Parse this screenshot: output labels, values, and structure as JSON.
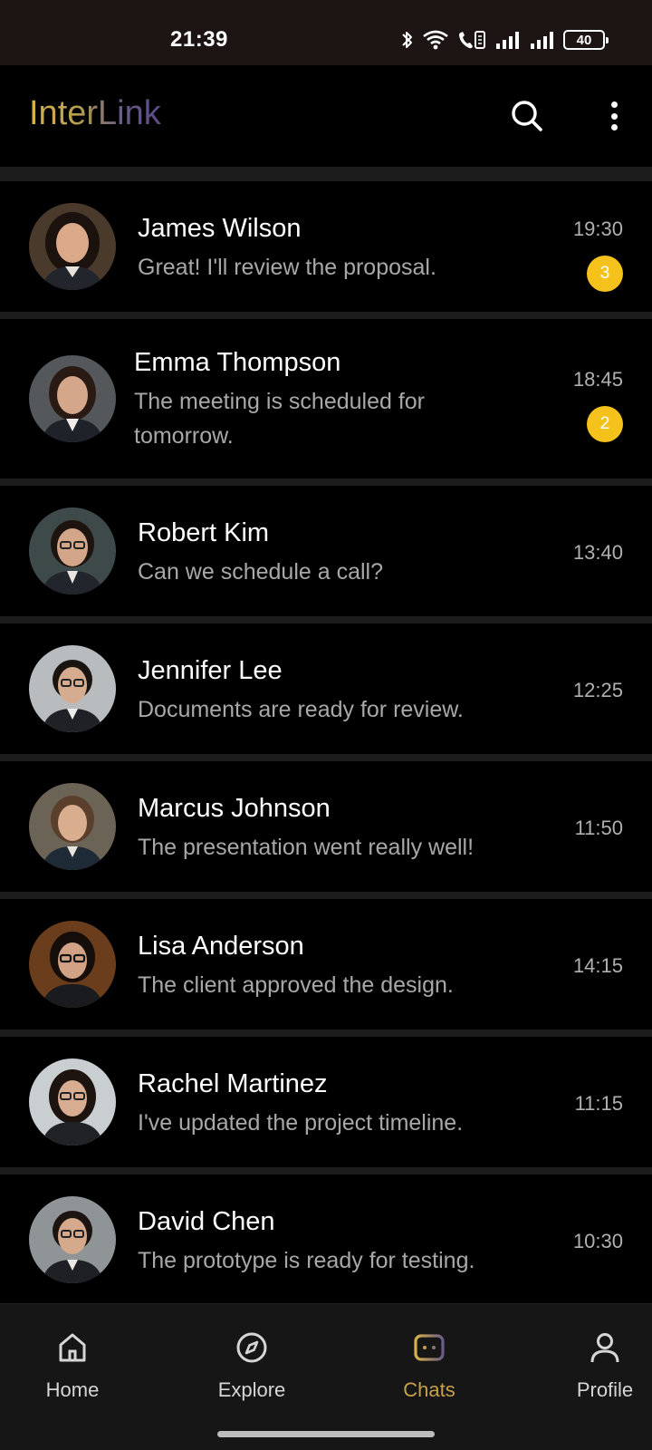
{
  "status_bar": {
    "time": "21:39",
    "icons": [
      "bluetooth-icon",
      "wifi-icon",
      "volte-call-icon",
      "signal-icon",
      "signal-icon"
    ],
    "battery": "40"
  },
  "app_bar": {
    "title": "InterLink",
    "title_gradient": [
      "#d6b24a",
      "#5b4a88"
    ],
    "icons": [
      "search-icon",
      "more-vertical-icon"
    ]
  },
  "chats": [
    {
      "name": "James Wilson",
      "preview": "Great! I'll review the proposal.",
      "time": "19:30",
      "unread": "3"
    },
    {
      "name": "Emma Thompson",
      "preview": "The meeting is scheduled for tomorrow.",
      "time": "18:45",
      "unread": "2"
    },
    {
      "name": "Robert Kim",
      "preview": "Can we schedule a call?",
      "time": "13:40",
      "unread": ""
    },
    {
      "name": "Jennifer Lee",
      "preview": "Documents are ready for review.",
      "time": "12:25",
      "unread": ""
    },
    {
      "name": "Marcus Johnson",
      "preview": "The presentation went really well!",
      "time": "11:50",
      "unread": ""
    },
    {
      "name": "Lisa Anderson",
      "preview": "The client approved the design.",
      "time": "14:15",
      "unread": ""
    },
    {
      "name": "Rachel Martinez",
      "preview": "I've updated the project timeline.",
      "time": "11:15",
      "unread": ""
    },
    {
      "name": "David Chen",
      "preview": "The prototype is ready for testing.",
      "time": "10:30",
      "unread": ""
    }
  ],
  "bottom_nav": {
    "items": [
      {
        "label": "Home",
        "icon": "home-icon"
      },
      {
        "label": "Explore",
        "icon": "compass-icon"
      },
      {
        "label": "Chats",
        "icon": "chat-icon",
        "active": true
      },
      {
        "label": "Profile",
        "icon": "person-icon"
      }
    ]
  },
  "colors": {
    "background": "#000000",
    "accent": "#c7a04a",
    "badge": "#f5c21b",
    "separator": "#1c1c1c",
    "nav_background": "#161616"
  }
}
